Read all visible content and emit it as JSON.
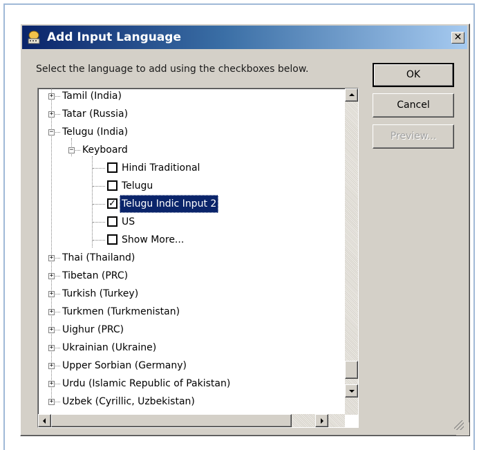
{
  "dialog": {
    "title": "Add Input Language",
    "close_glyph": "✕",
    "instructions": "Select the language to add using the checkboxes below."
  },
  "buttons": {
    "ok": "OK",
    "cancel": "Cancel",
    "preview": "Preview..."
  },
  "tree": {
    "languages_before": [
      "Tamil (India)",
      "Tatar (Russia)"
    ],
    "expanded_language": "Telugu (India)",
    "group": "Keyboard",
    "keyboards": [
      {
        "label": "Hindi Traditional",
        "checked": false
      },
      {
        "label": "Telugu",
        "checked": false
      },
      {
        "label": "Telugu Indic Input 2",
        "checked": true
      },
      {
        "label": "US",
        "checked": false
      },
      {
        "label": "Show More...",
        "checked": false
      }
    ],
    "languages_after": [
      "Thai (Thailand)",
      "Tibetan (PRC)",
      "Turkish (Turkey)",
      "Turkmen (Turkmenistan)",
      "Uighur (PRC)",
      "Ukrainian (Ukraine)",
      "Upper Sorbian (Germany)",
      "Urdu (Islamic Republic of Pakistan)",
      "Uzbek (Cyrillic, Uzbekistan)"
    ]
  },
  "icons": {
    "title": "input-language-icon",
    "expand": "plus-box-icon",
    "collapse": "minus-box-icon",
    "check": "checkmark-icon",
    "resize": "resize-grip-icon"
  },
  "colors": {
    "titlebar_start": "#0a246a",
    "titlebar_end": "#a6caf0",
    "face": "#d4d0c8",
    "selection": "#0a246a"
  }
}
